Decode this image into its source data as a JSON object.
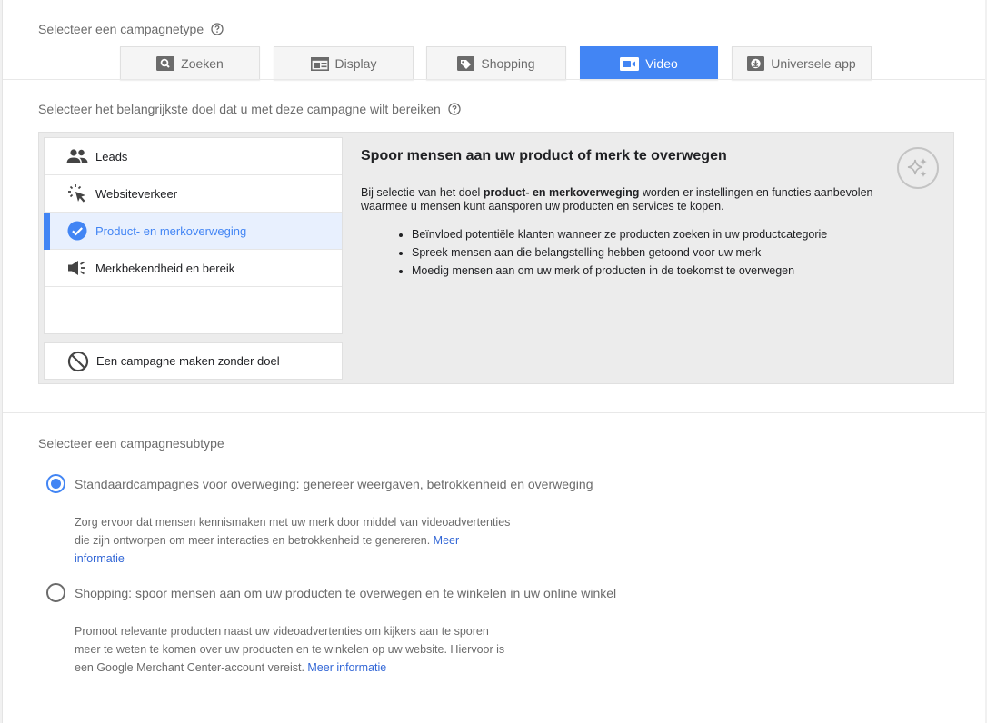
{
  "campaign_type": {
    "title": "Selecteer een campagnetype",
    "tabs": [
      {
        "label": "Zoeken",
        "icon": "search-icon"
      },
      {
        "label": "Display",
        "icon": "display-icon"
      },
      {
        "label": "Shopping",
        "icon": "shopping-tag-icon"
      },
      {
        "label": "Video",
        "icon": "video-camera-icon"
      },
      {
        "label": "Universele app",
        "icon": "app-download-icon"
      }
    ],
    "selected_tab": "Video"
  },
  "goal": {
    "title": "Selecteer het belangrijkste doel dat u met deze campagne wilt bereiken",
    "items": [
      {
        "label": "Leads",
        "icon": "people-icon"
      },
      {
        "label": "Websiteverkeer",
        "icon": "cursor-click-icon"
      },
      {
        "label": "Product- en merkoverweging",
        "icon": "check-circle-icon"
      },
      {
        "label": "Merkbekendheid en bereik",
        "icon": "megaphone-icon"
      }
    ],
    "selected": "Product- en merkoverweging",
    "no_goal_label": "Een campagne maken zonder doel",
    "description": {
      "heading": "Spoor mensen aan uw product of merk te overwegen",
      "para_before": "Bij selectie van het doel ",
      "para_bold": "product- en merkoverweging",
      "para_after": " worden er instellingen en functies aanbevolen waarmee u mensen kunt aansporen uw producten en services te kopen.",
      "bullets": [
        "Beïnvloed potentiële klanten wanneer ze producten zoeken in uw productcategorie",
        "Spreek mensen aan die belangstelling hebben getoond voor uw merk",
        "Moedig mensen aan om uw merk of producten in de toekomst te overwegen"
      ]
    }
  },
  "subtype": {
    "title": "Selecteer een campagnesubtype",
    "options": [
      {
        "label": "Standaardcampagnes voor overweging: genereer weergaven, betrokkenheid en overweging",
        "checked": true,
        "desc_line1": "Zorg ervoor dat mensen kennismaken met uw merk door middel van videoadvertenties",
        "desc_line2": "die zijn ontworpen om meer interacties en betrokkenheid te genereren. ",
        "link_part1": "Meer",
        "link_part2": "informatie"
      },
      {
        "label": "Shopping: spoor mensen aan om uw producten te overwegen en te winkelen in uw online winkel",
        "checked": false,
        "desc_line1": "Promoot relevante producten naast uw videoadvertenties om kijkers aan te sporen",
        "desc_line2": "meer te weten te komen over uw producten en te winkelen op uw website. Hiervoor is",
        "desc_line3": "een Google Merchant Center-account vereist. ",
        "link": "Meer informatie"
      }
    ]
  },
  "colors": {
    "accent": "#4285f4",
    "link": "#3367d6",
    "panel_bg": "#ececec",
    "muted_text": "#6b6b6b"
  }
}
